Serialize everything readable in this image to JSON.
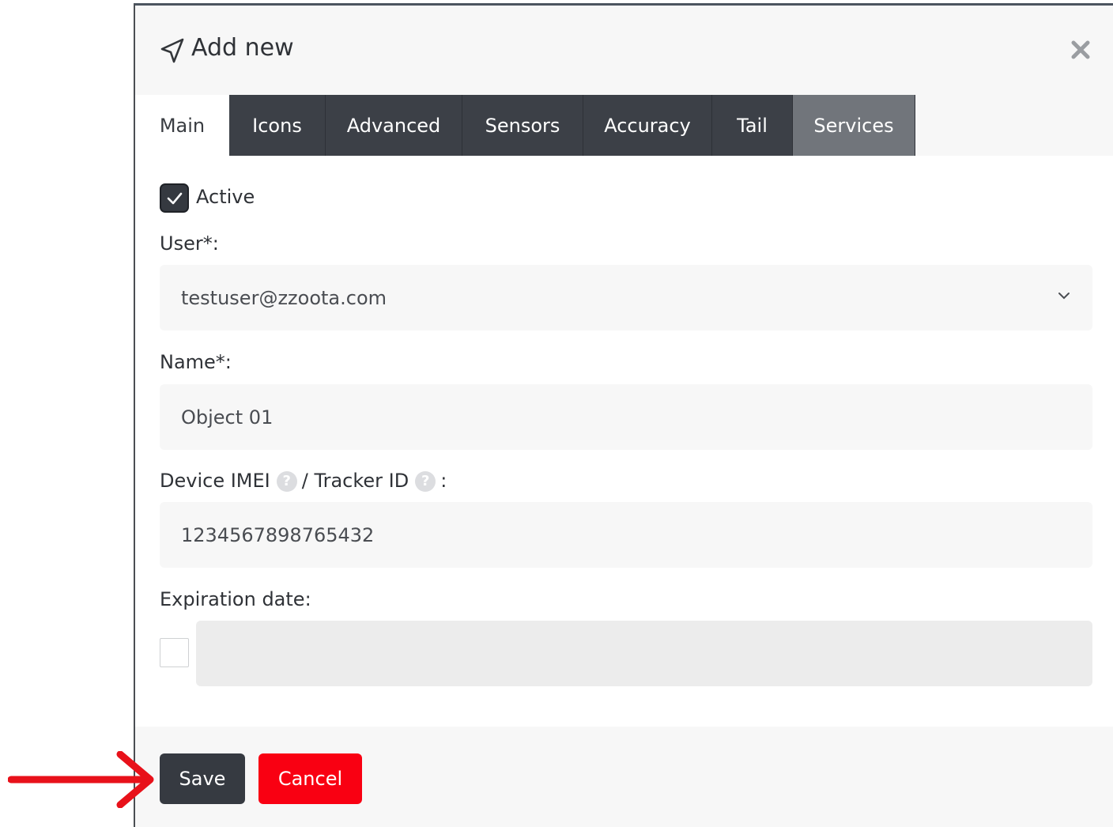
{
  "dialog": {
    "title": "Add new",
    "title_icon": "paper-plane-icon",
    "close_icon": "close-icon"
  },
  "tabs": [
    {
      "label": "Main",
      "active": true
    },
    {
      "label": "Icons"
    },
    {
      "label": "Advanced"
    },
    {
      "label": "Sensors"
    },
    {
      "label": "Accuracy"
    },
    {
      "label": "Tail"
    },
    {
      "label": "Services"
    }
  ],
  "form": {
    "active_label": "Active",
    "active_checked": true,
    "user_label": "User*:",
    "user_value": "testuser@zzoota.com",
    "name_label": "Name*:",
    "name_value": "Object 01",
    "imei_label_part1": "Device IMEI",
    "imei_label_part2": "/ Tracker ID",
    "imei_label_part3": ":",
    "help_glyph": "?",
    "imei_value": "1234567898765432",
    "expiration_label": "Expiration date:",
    "expiration_checked": false,
    "expiration_value": ""
  },
  "footer": {
    "save_label": "Save",
    "cancel_label": "Cancel"
  },
  "colors": {
    "tab_dark": "#3c4047",
    "tab_services": "#71757b",
    "save_button": "#363a41",
    "cancel_button": "#f90012",
    "annotation_arrow": "#e8111a"
  }
}
